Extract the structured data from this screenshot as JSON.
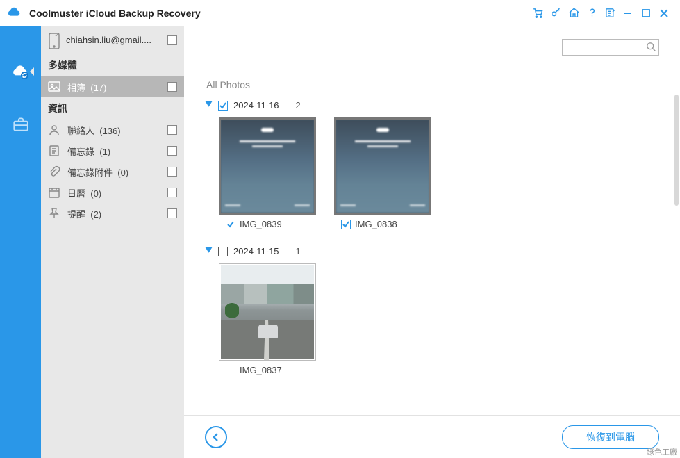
{
  "titlebar": {
    "title": "Coolmuster iCloud Backup Recovery"
  },
  "account": {
    "email": "chiahsin.liu@gmail...."
  },
  "sidebar": {
    "group1_label": "多媒體",
    "group2_label": "資訊",
    "items": [
      {
        "label": "相簿",
        "count": "(17)",
        "selected": true
      },
      {
        "label": "聯絡人",
        "count": "(136)"
      },
      {
        "label": "備忘錄",
        "count": "(1)"
      },
      {
        "label": "備忘錄附件",
        "count": "(0)"
      },
      {
        "label": "日曆",
        "count": "(0)"
      },
      {
        "label": "提醒",
        "count": "(2)"
      }
    ]
  },
  "main": {
    "all_photos_label": "All Photos",
    "groups": [
      {
        "date": "2024-11-16",
        "count": "2",
        "checked": true,
        "photos": [
          {
            "name": "IMG_0839",
            "checked": true,
            "kind": "lock"
          },
          {
            "name": "IMG_0838",
            "checked": true,
            "kind": "lock"
          }
        ]
      },
      {
        "date": "2024-11-15",
        "count": "1",
        "checked": false,
        "photos": [
          {
            "name": "IMG_0837",
            "checked": false,
            "kind": "street"
          }
        ]
      }
    ]
  },
  "bottom": {
    "restore_label": "恢復到電腦"
  },
  "watermark": "綠色工廠",
  "search": {
    "placeholder": ""
  }
}
